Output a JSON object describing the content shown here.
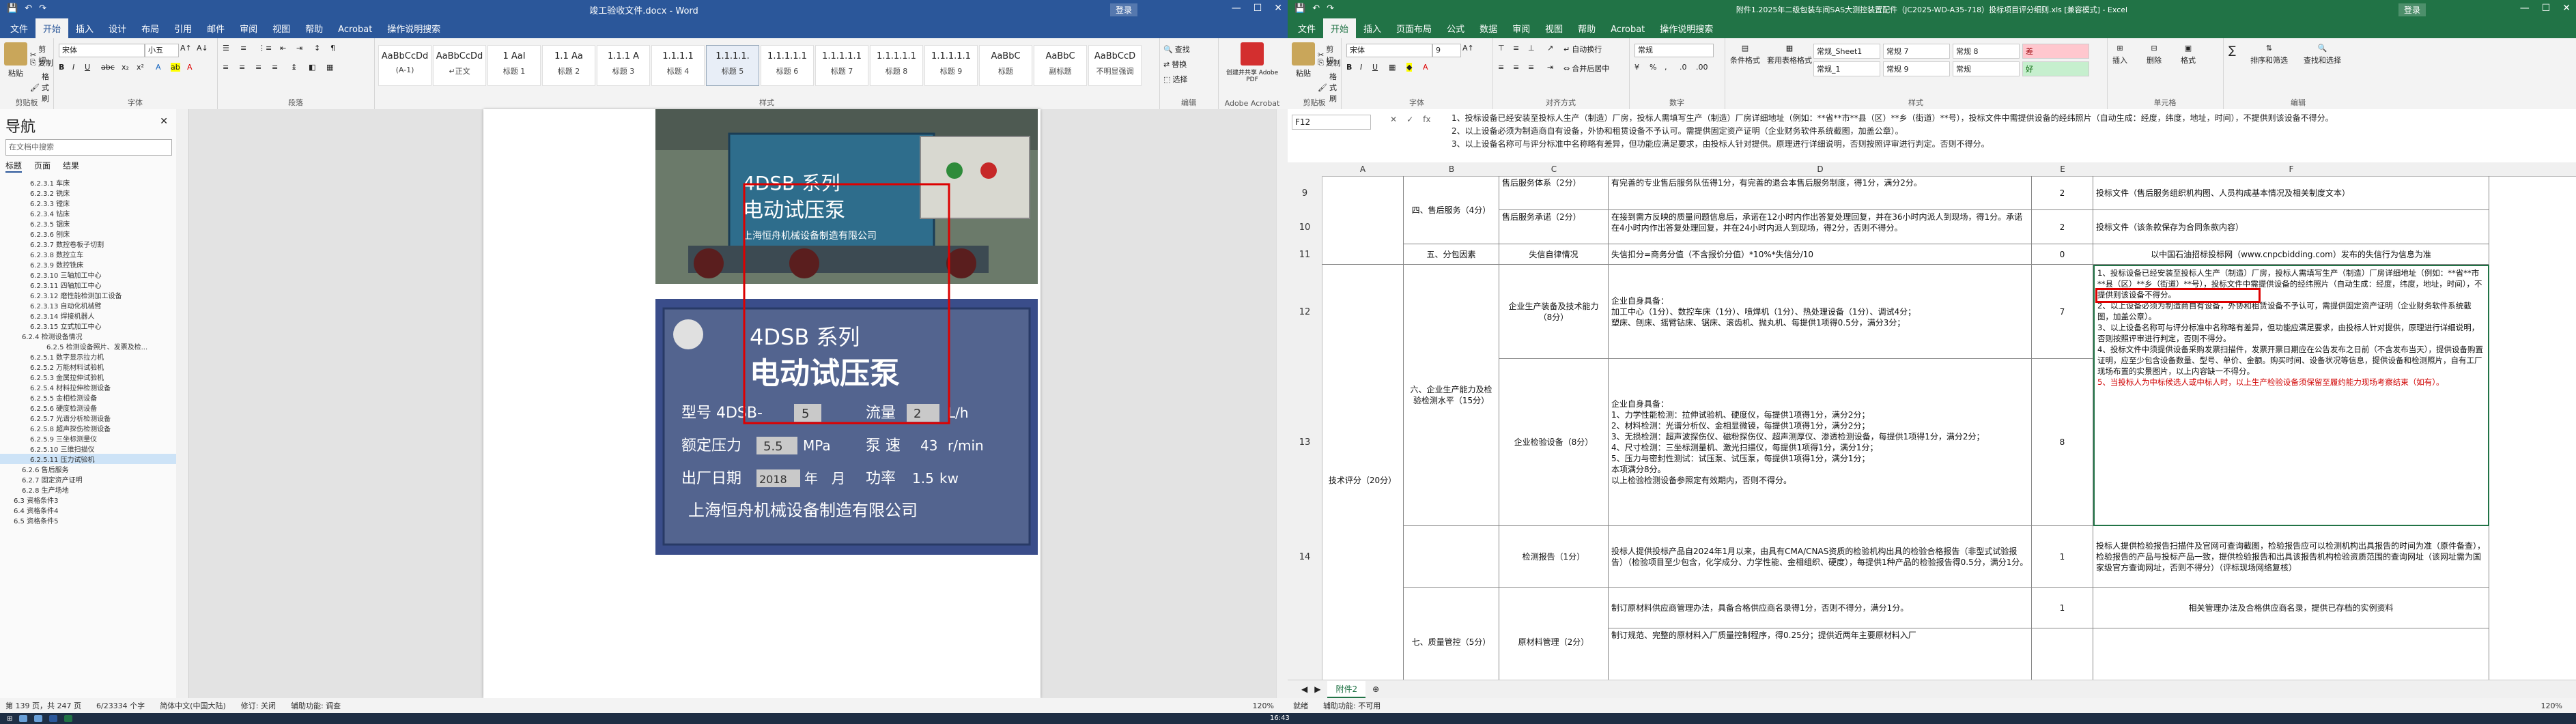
{
  "word": {
    "title": "竣工验收文件.docx - Word",
    "user": "登录",
    "tabs": [
      "文件",
      "开始",
      "插入",
      "设计",
      "布局",
      "引用",
      "邮件",
      "审阅",
      "视图",
      "帮助",
      "Acrobat",
      "操作说明搜索"
    ],
    "active_tab": "开始",
    "ribbon": {
      "paste": "粘贴",
      "cut": "剪切",
      "copy": "复制",
      "format_painter": "格式刷",
      "clipboard_label": "剪贴板",
      "font_name": "宋体",
      "font_size": "小五",
      "font_label": "字体",
      "paragraph_label": "段落",
      "styles_label": "样式",
      "find": "查找",
      "replace": "替换",
      "select": "选择",
      "editing_label": "编辑",
      "acrobat": "创建并共享 Adobe PDF",
      "acrobat_label": "Adobe Acrobat",
      "styles": [
        {
          "preview": "AaBbCcDd",
          "name": "(A-1)"
        },
        {
          "preview": "AaBbCcDd",
          "name": "↵正文"
        },
        {
          "preview": "1 AaI",
          "name": "标题 1"
        },
        {
          "preview": "1.1 Aa",
          "name": "标题 2"
        },
        {
          "preview": "1.1.1 A",
          "name": "标题 3"
        },
        {
          "preview": "1.1.1.1",
          "name": "标题 4"
        },
        {
          "preview": "1.1.1.1.",
          "name": "标题 5"
        },
        {
          "preview": "1.1.1.1.1",
          "name": "标题 6"
        },
        {
          "preview": "1.1.1.1.1",
          "name": "标题 7"
        },
        {
          "preview": "1.1.1.1.1",
          "name": "标题 8"
        },
        {
          "preview": "1.1.1.1.1",
          "name": "标题 9"
        },
        {
          "preview": "AaBbC",
          "name": "标题"
        },
        {
          "preview": "AaBbC",
          "name": "副标题"
        },
        {
          "preview": "AaBbCcD",
          "name": "不明显强调"
        }
      ]
    },
    "nav": {
      "title": "导航",
      "search_placeholder": "在文档中搜索",
      "tabs": [
        "标题",
        "页面",
        "结果"
      ],
      "items": [
        "6.2.3.1 车床",
        "6.2.3.2 铣床",
        "6.2.3.3 镗床",
        "6.2.3.4 钻床",
        "6.2.3.5 锯床",
        "6.2.3.6 刨床",
        "6.2.3.7 数控卷板子切割",
        "6.2.3.8 数控立车",
        "6.2.3.9 数控铣床",
        "6.2.3.10 三轴加工中心",
        "6.2.3.11 四轴加工中心",
        "6.2.3.12 磨性能检测加工设备",
        "6.2.3.13 自动化机械臂",
        "6.2.3.14 焊接机器人",
        "6.2.3.15 立式加工中心",
        "6.2.4 检测设备情况",
        "6.2.5 检测设备照片、发票及检...",
        "6.2.5.1 数字显示拉力机",
        "6.2.5.2 万能材料试验机",
        "6.2.5.3 金属拉伸试验机",
        "6.2.5.4 材料拉伸检测设备",
        "6.2.5.5 金相检测设备",
        "6.2.5.6 硬度检测设备",
        "6.2.5.7 光谱分析检测设备",
        "6.2.5.8 超声探伤检测设备",
        "6.2.5.9 三坐标测量仪",
        "6.2.5.10 三维扫描仪",
        "6.2.5.11 压力试验机",
        "6.2.6 售后服务",
        "6.2.7 固定资产证明",
        "6.2.8 生产场地",
        "6.3 资格条件3",
        "6.4 资格条件4",
        "6.5 资格条件5"
      ],
      "selected_index": 27
    },
    "photo1": {
      "brand": "4DSB-系列",
      "title": "电动试压泵",
      "maker": "上海恒舟机械设备制造有限公司"
    },
    "photo2": {
      "series": "4DSB 系列",
      "title": "电动试压泵",
      "model_label": "型号 4DSB-",
      "model_val": "5",
      "flow_label": "流量",
      "flow_val": "2",
      "flow_unit": "L/h",
      "pressure_label": "额定压力",
      "pressure_val": "5.5",
      "pressure_unit": "MPa",
      "rpm_label": "泵 速",
      "rpm_val": "43",
      "rpm_unit": "r/min",
      "date_label": "出厂日期",
      "date_year": "2018",
      "date_month": "年",
      "date_day": "月",
      "power_label": "功率",
      "power_val": "1.5",
      "power_unit": "kw",
      "maker": "上海恒舟机械设备制造有限公司"
    },
    "status": [
      "第 139 页，共 247 页",
      "6/23334 个字",
      "简体中文(中国大陆)",
      "修订: 关闭",
      "辅助功能: 调查"
    ],
    "zoom": "120%"
  },
  "excel": {
    "title": "附件1.2025年二级包装车间SAS大测控装置配件（JC2025-WD-A35-718）投标项目评分细则.xls [兼容模式] - Excel",
    "user": "登录",
    "tabs": [
      "文件",
      "开始",
      "插入",
      "页面布局",
      "公式",
      "数据",
      "审阅",
      "视图",
      "帮助",
      "Acrobat",
      "操作说明搜索"
    ],
    "active_tab": "开始",
    "ribbon": {
      "paste": "粘贴",
      "cut": "剪切",
      "copy": "复制",
      "format_painter": "格式刷",
      "clipboard_label": "剪贴板",
      "font_name": "宋体",
      "font_size": "9",
      "font_label": "字体",
      "align_label": "对齐方式",
      "wrap": "自动换行",
      "merge": "合并后居中",
      "number_format": "常规",
      "number_label": "数字",
      "cond_format": "条件格式",
      "table_format": "套用表格格式",
      "styles_label": "样式",
      "cell_styles": [
        {
          "name": "常规_Sheet1",
          "cls": "n"
        },
        {
          "name": "常规 7",
          "cls": "n"
        },
        {
          "name": "常规 8",
          "cls": "n"
        },
        {
          "name": "差",
          "cls": "bad"
        },
        {
          "name": "常规_1",
          "cls": "n"
        },
        {
          "name": "常规 9",
          "cls": "n"
        },
        {
          "name": "常规",
          "cls": "n"
        },
        {
          "name": "好",
          "cls": "good"
        }
      ],
      "insert": "插入",
      "delete": "删除",
      "format": "格式",
      "cells_label": "单元格",
      "sum": "∑",
      "sort": "排序和筛选",
      "find": "查找和选择",
      "editing_label": "编辑"
    },
    "name_box": "F12",
    "formula_lines": [
      "1、投标设备已经安装至投标人生产（制造）厂房，投标人需填写生产（制造）厂房详细地址（例如：**省**市**县（区）**乡（街道）**号），投标文件中需提供设备的经纬照片（自动生成：经度，纬度，地址，时间），不提供则该设备不得分。",
      "2、以上设备必须为制造商自有设备，外协和租赁设备不予认可。需提供固定资产证明（企业财务软件系统截图，加盖公章）。",
      "3、以上设备名称可与评分标准中名称略有差异，但功能应满足要求，由投标人针对提供。原理进行详细说明，否则按照评审进行判定。否则不得分。"
    ],
    "columns": [
      "A",
      "B",
      "C",
      "D",
      "E",
      "F"
    ],
    "rows": [
      "9",
      "10",
      "11",
      "12",
      "13",
      "14"
    ],
    "cells": {
      "b9": "四、售后服务（4分）",
      "c9": "售后服务体系（2分）",
      "d9": "有完善的专业售后服务队伍得1分，有完善的退会本售后服务制度，得1分，满分2分。",
      "e9": "2",
      "f9": "投标文件（售后服务组织机构图、人员构成基本情况及相关制度文本）",
      "c10": "售后服务承诺（2分）",
      "d10": "在接到需方反映的质量问题信息后，承诺在12小时内作出答复处理回复，并在36小时内派人到现场，得1分。承诺在4小时内作出答复处理回复，并在24小时内派人到现场，得2分，否则不得分。",
      "e10": "2",
      "f10": "投标文件（该条款保存为合同条款内容）",
      "b11": "五、分包因素",
      "c11": "失信自律情况",
      "d11": "失信扣分=商务分值（不含报价分值）*10%*失信分/10",
      "e11": "0",
      "f11": "以中国石油招标投标网（www.cnpcbidding.com）发布的失信行为信息为准",
      "a12": "技术评分（20分）",
      "b12": "六、企业生产能力及检验检测水平（15分）",
      "c12": "企业生产装备及技术能力（8分）",
      "d12": "企业自身具备：\n加工中心（1分）、数控车床（1分）、喷焊机（1分）、热处理设备（1分）、调试4分；\n塑床、刨床、摇臂钻床、锯床、滚齿机、抛丸机、每提供1项得0.5分，满分3分；",
      "e12": "7",
      "f12a": "1、投标设备已经安装至投标人生产（制造）厂房，投标人需填写生产（制造）厂房详细地址（例如：**省**市**县（区）**乡（街道）**号），投标文件中需提供设备的经纬照片（自动生成：经度，纬度，地址，时间），不提供则该设备不得分。",
      "f12b": "2、以上设备必须为制造商自有设备，外协和租赁设备不予认可，需提供固定资产证明（企业财务软件系统截图，加盖公章）。",
      "f12c": "3、以上设备名称可与评分标准中名称略有差异，但功能应满足要求，由投标人针对提供，原理进行详细说明，否则按照评审进行判定，否则不得分。",
      "f12d": "4、投标文件中须提供设备采购发票扫描件，发票开票日期应在公告发布之日前（不含发布当天），提供设备购置证明，应至少包含设备数量、型号、单价、金额。购买时间、设备状况等信息，提供设备和检测照片，自有工厂现场布置的实景图片，以上内容缺一不得分。",
      "f12e": "5、当投标人为中标候选人或中标人时，以上生产检验设备须保留至履约能力现场考察结束（如有）。",
      "c13": "企业检验设备（8分）",
      "d13": "企业自身具备：\n1、力学性能检测：拉伸试验机、硬度仪，每提供1项得1分，满分2分；\n2、材料检测：光谱分析仪、金相显微镜，每提供1项得1分，满分2分；\n3、无损检测：超声波探伤仪、磁粉探伤仪、超声测厚仪、渗透检测设备，每提供1项得1分，满分2分；\n4、尺寸检测：三坐标测量机、激光扫描仪，每提供1项得1分，满分1分；\n5、压力与密封性测试：试压泵、试压泵，每提供1项得1分，满分1分；\n本项满分8分。\n以上检验检测设备参照定有效期内，否则不得分。",
      "e13": "8",
      "c14": "检测报告（1分）",
      "d14": "投标人提供投标产品自2024年1月以来，由具有CMA/CNAS资质的检验机构出具的检验合格报告（非型式试验报告）（检验项目至少包含，化学成分、力学性能、金相组织、硬度），每提供1种产品的检验报告得0.5分，满分1分。",
      "e14": "1",
      "f14": "投标人提供检验报告扫描件及官网可查询截图，检验报告应可以检测机构出具报告的时间为准（原件备查），检验报告的产品与投标产品一致，提供检验报告和出具该报告机构检验资质范围的查询网址（该网址需为国家级官方查询网址，否则不得分）（评标现场网络复核）",
      "b15": "七、质量管控（5分）",
      "c15": "原材料管理（2分）",
      "d15": "制订原材料供应商管理办法，具备合格供应商名录得1分，否则不得分，满分1分。",
      "e15": "1",
      "f15": "相关管理办法及合格供应商名录，提供已存档的实例资料",
      "d16": "制订规范、完整的原材料入厂质量控制程序，得0.25分；提供近两年主要原材料入厂"
    },
    "sheet_tab": "附件2",
    "status": [
      "就绪",
      "辅助功能: 不可用"
    ],
    "zoom": "120%",
    "taskbar_time": "16:43"
  }
}
